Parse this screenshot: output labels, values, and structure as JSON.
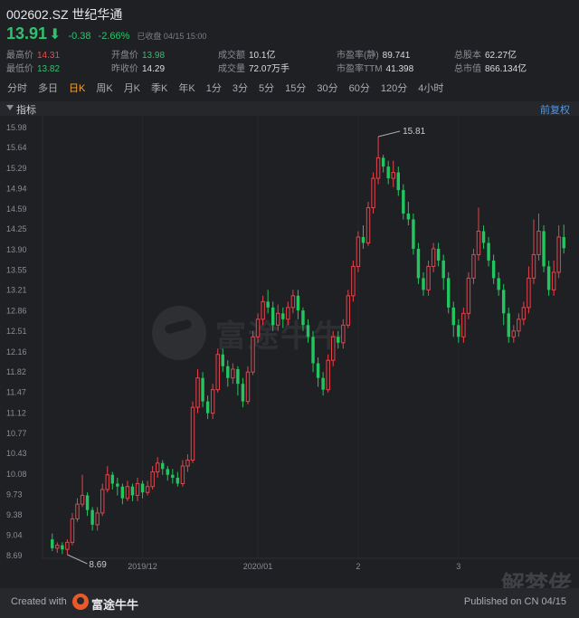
{
  "header": {
    "title": "002602.SZ 世纪华通",
    "price": "13.91",
    "change": "-0.38",
    "change_pct": "-2.66%",
    "status": "已收盘 04/15 15:00",
    "stats": [
      {
        "label": "最高价",
        "value": "14.31",
        "tone": "red"
      },
      {
        "label": "开盘价",
        "value": "13.98",
        "tone": "green"
      },
      {
        "label": "成交额",
        "value": "10.1亿",
        "tone": ""
      },
      {
        "label": "市盈率(静)",
        "value": "89.741",
        "tone": ""
      },
      {
        "label": "总股本",
        "value": "62.27亿",
        "tone": ""
      },
      {
        "label": "最低价",
        "value": "13.82",
        "tone": "green"
      },
      {
        "label": "昨收价",
        "value": "14.29",
        "tone": ""
      },
      {
        "label": "成交量",
        "value": "72.07万手",
        "tone": ""
      },
      {
        "label": "市盈率TTM",
        "value": "41.398",
        "tone": ""
      },
      {
        "label": "总市值",
        "value": "866.134亿",
        "tone": ""
      }
    ]
  },
  "periods": [
    "分时",
    "多日",
    "日K",
    "周K",
    "月K",
    "季K",
    "年K",
    "1分",
    "3分",
    "5分",
    "15分",
    "30分",
    "60分",
    "120分",
    "4小时"
  ],
  "active_period": "日K",
  "toolbar": {
    "indicator_label": "指标",
    "adjust_label": "前复权"
  },
  "chart_data": {
    "type": "candlestick",
    "y_ticks": [
      "15.98",
      "15.64",
      "15.29",
      "14.94",
      "14.59",
      "14.25",
      "13.90",
      "13.55",
      "13.21",
      "12.86",
      "12.51",
      "12.16",
      "11.82",
      "11.47",
      "11.12",
      "10.77",
      "10.43",
      "10.08",
      "9.73",
      "9.38",
      "9.04",
      "8.69"
    ],
    "ylim": [
      8.69,
      15.98
    ],
    "x_ticks": [
      {
        "label": "2019/12",
        "index": 18
      },
      {
        "label": "2020/01",
        "index": 41
      },
      {
        "label": "2",
        "index": 61
      },
      {
        "label": "3",
        "index": 81
      }
    ],
    "max_label": "15.81",
    "min_label": "8.69",
    "colors": {
      "up": "#e8424a",
      "down": "#22c55e"
    },
    "candles": [
      [
        8.95,
        8.8,
        9.05,
        8.75
      ],
      [
        8.8,
        8.85,
        8.9,
        8.72
      ],
      [
        8.85,
        8.78,
        8.9,
        8.7
      ],
      [
        8.78,
        8.9,
        8.95,
        8.69
      ],
      [
        8.9,
        9.3,
        9.4,
        8.85
      ],
      [
        9.3,
        9.55,
        9.65,
        9.25
      ],
      [
        9.55,
        9.7,
        10.05,
        9.5
      ],
      [
        9.7,
        9.45,
        9.75,
        9.35
      ],
      [
        9.45,
        9.2,
        9.5,
        9.1
      ],
      [
        9.2,
        9.4,
        9.5,
        9.1
      ],
      [
        9.4,
        9.8,
        9.9,
        9.35
      ],
      [
        9.8,
        10.05,
        10.2,
        9.75
      ],
      [
        10.05,
        9.9,
        10.1,
        9.8
      ],
      [
        9.9,
        9.85,
        10.0,
        9.7
      ],
      [
        9.85,
        9.65,
        9.9,
        9.55
      ],
      [
        9.65,
        9.85,
        9.95,
        9.6
      ],
      [
        9.85,
        9.7,
        9.9,
        9.6
      ],
      [
        9.7,
        9.9,
        10.0,
        9.6
      ],
      [
        9.9,
        9.75,
        9.95,
        9.65
      ],
      [
        9.75,
        9.85,
        9.95,
        9.7
      ],
      [
        9.85,
        10.1,
        10.2,
        9.8
      ],
      [
        10.1,
        10.25,
        10.35,
        10.0
      ],
      [
        10.25,
        10.15,
        10.3,
        10.05
      ],
      [
        10.15,
        10.05,
        10.2,
        9.95
      ],
      [
        10.05,
        10.0,
        10.15,
        9.9
      ],
      [
        10.0,
        9.9,
        10.1,
        9.85
      ],
      [
        9.9,
        10.2,
        10.3,
        9.85
      ],
      [
        10.2,
        10.3,
        10.4,
        10.1
      ],
      [
        10.3,
        11.2,
        11.3,
        10.25
      ],
      [
        11.2,
        11.7,
        11.85,
        11.1
      ],
      [
        11.7,
        11.3,
        11.8,
        11.2
      ],
      [
        11.3,
        11.1,
        11.4,
        11.0
      ],
      [
        11.1,
        11.5,
        11.6,
        11.0
      ],
      [
        11.5,
        12.1,
        12.2,
        11.45
      ],
      [
        12.1,
        11.9,
        12.2,
        11.8
      ],
      [
        11.9,
        11.7,
        12.0,
        11.55
      ],
      [
        11.7,
        11.85,
        11.95,
        11.6
      ],
      [
        11.85,
        11.6,
        11.9,
        11.4
      ],
      [
        11.6,
        11.3,
        11.7,
        11.2
      ],
      [
        11.3,
        11.8,
        11.9,
        11.25
      ],
      [
        11.8,
        12.4,
        12.5,
        11.75
      ],
      [
        12.4,
        12.7,
        12.8,
        12.3
      ],
      [
        12.7,
        13.0,
        13.1,
        12.6
      ],
      [
        13.0,
        12.9,
        13.2,
        12.8
      ],
      [
        12.9,
        12.6,
        13.0,
        12.5
      ],
      [
        12.6,
        12.8,
        12.95,
        12.5
      ],
      [
        12.8,
        12.7,
        12.9,
        12.55
      ],
      [
        12.7,
        12.9,
        13.0,
        12.6
      ],
      [
        12.9,
        13.1,
        13.2,
        12.8
      ],
      [
        13.1,
        12.85,
        13.2,
        12.7
      ],
      [
        12.85,
        12.6,
        12.9,
        12.5
      ],
      [
        12.6,
        12.4,
        12.7,
        12.3
      ],
      [
        12.4,
        11.95,
        12.5,
        11.8
      ],
      [
        11.95,
        11.7,
        12.05,
        11.55
      ],
      [
        11.7,
        11.5,
        11.8,
        11.4
      ],
      [
        11.5,
        12.0,
        12.1,
        11.45
      ],
      [
        12.0,
        12.4,
        12.5,
        11.9
      ],
      [
        12.4,
        12.3,
        12.5,
        12.2
      ],
      [
        12.3,
        12.6,
        12.7,
        12.2
      ],
      [
        12.6,
        13.1,
        13.2,
        12.55
      ],
      [
        13.1,
        13.6,
        13.7,
        13.0
      ],
      [
        13.6,
        14.1,
        14.2,
        13.5
      ],
      [
        14.1,
        14.0,
        14.3,
        13.9
      ],
      [
        14.0,
        14.6,
        14.7,
        13.95
      ],
      [
        14.6,
        15.1,
        15.2,
        14.5
      ],
      [
        15.1,
        15.45,
        15.81,
        15.0
      ],
      [
        15.45,
        15.3,
        15.5,
        15.2
      ],
      [
        15.3,
        15.1,
        15.4,
        15.0
      ],
      [
        15.1,
        15.2,
        15.4,
        14.95
      ],
      [
        15.2,
        14.9,
        15.3,
        14.8
      ],
      [
        14.9,
        14.5,
        15.0,
        14.4
      ],
      [
        14.5,
        14.4,
        14.7,
        14.3
      ],
      [
        14.4,
        13.9,
        14.5,
        13.8
      ],
      [
        13.9,
        13.4,
        14.0,
        13.3
      ],
      [
        13.4,
        13.2,
        13.5,
        13.1
      ],
      [
        13.2,
        13.6,
        13.7,
        13.1
      ],
      [
        13.6,
        13.9,
        14.0,
        13.5
      ],
      [
        13.9,
        13.7,
        14.0,
        13.6
      ],
      [
        13.7,
        13.4,
        13.8,
        13.2
      ],
      [
        13.4,
        12.9,
        13.5,
        12.8
      ],
      [
        12.9,
        12.6,
        13.0,
        12.4
      ],
      [
        12.6,
        12.4,
        12.7,
        12.3
      ],
      [
        12.4,
        12.8,
        12.9,
        12.3
      ],
      [
        12.8,
        13.4,
        13.5,
        12.7
      ],
      [
        13.4,
        13.8,
        13.9,
        13.3
      ],
      [
        13.8,
        14.2,
        14.6,
        13.7
      ],
      [
        14.2,
        14.0,
        14.3,
        13.9
      ],
      [
        14.0,
        13.7,
        14.1,
        13.6
      ],
      [
        13.7,
        13.4,
        13.8,
        13.3
      ],
      [
        13.4,
        13.2,
        13.5,
        13.1
      ],
      [
        13.2,
        12.8,
        13.3,
        12.6
      ],
      [
        12.8,
        12.4,
        12.9,
        12.3
      ],
      [
        12.4,
        12.5,
        12.6,
        12.3
      ],
      [
        12.5,
        12.7,
        12.8,
        12.4
      ],
      [
        12.7,
        12.9,
        13.0,
        12.6
      ],
      [
        12.9,
        13.4,
        13.6,
        12.8
      ],
      [
        13.4,
        13.8,
        14.4,
        13.3
      ],
      [
        13.8,
        14.2,
        14.5,
        13.7
      ],
      [
        14.2,
        13.6,
        14.3,
        13.5
      ],
      [
        13.6,
        13.2,
        13.7,
        13.1
      ],
      [
        13.2,
        13.5,
        13.7,
        13.1
      ],
      [
        13.5,
        14.1,
        14.3,
        13.4
      ],
      [
        14.1,
        13.91,
        14.31,
        13.82
      ]
    ]
  },
  "footer": {
    "created_label": "Created with",
    "brand": "富途牛牛",
    "published": "Published on CN 04/15"
  },
  "watermark": {
    "text": "富途牛牛",
    "corner": "解梦佬"
  }
}
